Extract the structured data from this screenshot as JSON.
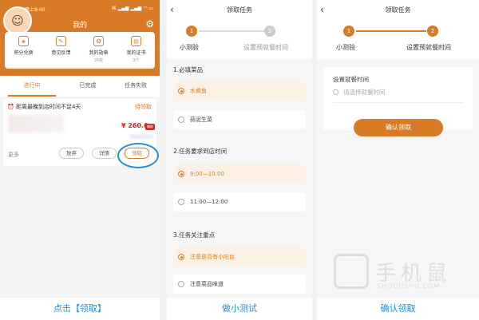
{
  "panel1": {
    "status_time": "晚上9:40",
    "status_icons": "⌘ ▂▄▆ ▂▄▆ ◠ ▭",
    "title": "我的",
    "menu": [
      {
        "label": "积分兑换",
        "sub": ""
      },
      {
        "label": "意见反馈",
        "sub": ""
      },
      {
        "label": "我的勋章",
        "sub": "26枚"
      },
      {
        "label": "我的证书",
        "sub": "3个"
      }
    ],
    "tabs": [
      "进行中",
      "已完成",
      "任务失败"
    ],
    "task": {
      "notice": "距离最晚到店时间不足4天",
      "status": "待领取",
      "price": "¥ 260.0",
      "badge": "赚取",
      "more": "更多",
      "btn_abandon": "放弃",
      "btn_detail": "详情",
      "btn_accept": "领取"
    },
    "caption": "点击【领取】"
  },
  "panel2": {
    "title": "领取任务",
    "steps": [
      {
        "num": "1",
        "label": "小测验"
      },
      {
        "num": "2",
        "label": "设置预就餐时间"
      }
    ],
    "sections": [
      {
        "title": "1.必填菜品",
        "options": [
          "水煮鱼",
          "蒜泥生菜"
        ]
      },
      {
        "title": "2.任务要求到店时间",
        "options": [
          "9:00—10:00",
          "11:00—12:00"
        ]
      },
      {
        "title": "3.任务关注重点",
        "options": [
          "注意是否有小吃台",
          "注意菜品味道"
        ]
      }
    ],
    "caption": "做小测试"
  },
  "panel3": {
    "title": "领取任务",
    "steps": [
      {
        "num": "1",
        "label": "小测验"
      },
      {
        "num": "2",
        "label": "设置预就餐时间"
      }
    ],
    "field_label": "设置就餐时间",
    "field_placeholder": "请选择就餐时间",
    "confirm": "确认领取",
    "caption": "确认领取"
  },
  "watermark": {
    "text": "手机鼠",
    "sub": "SHOUJISHU.COM"
  },
  "colors": {
    "accent": "#d97b26",
    "link": "#1f8fd6",
    "price": "#d0281e"
  }
}
